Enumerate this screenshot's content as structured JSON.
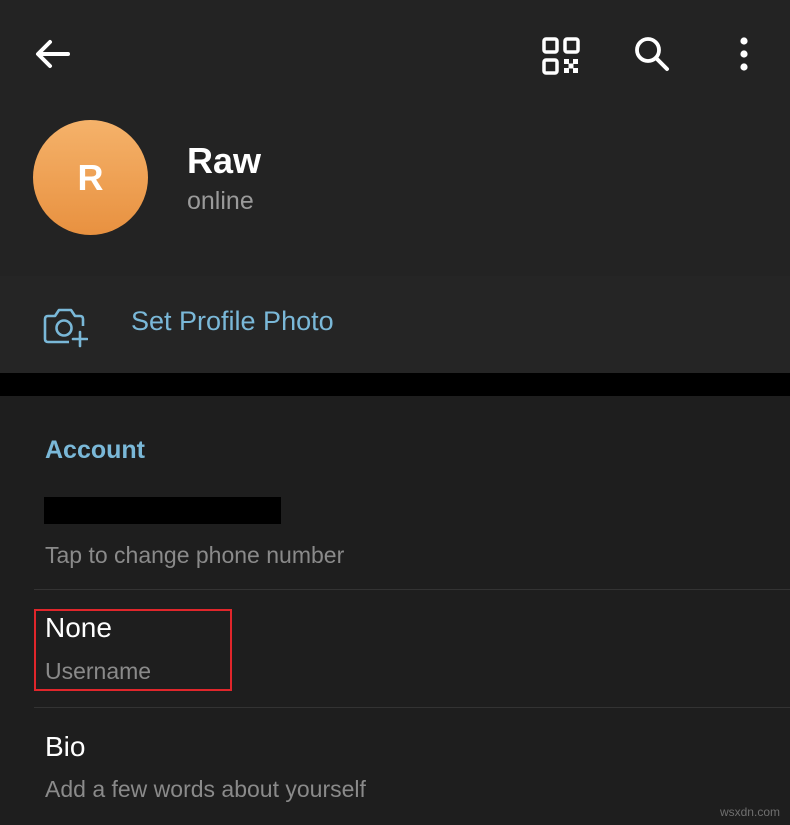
{
  "header": {
    "back_icon": "arrow-left-icon",
    "qr_icon": "qr-code-icon",
    "search_icon": "search-icon",
    "more_icon": "more-vertical-icon"
  },
  "profile": {
    "initial": "R",
    "name": "Raw",
    "status": "online",
    "avatar_color_top": "#f5b26a",
    "avatar_color_bottom": "#e89140"
  },
  "photo_row": {
    "icon": "camera-add-icon",
    "label": "Set Profile Photo"
  },
  "account": {
    "title": "Account",
    "phone": {
      "hint": "Tap to change phone number"
    },
    "username": {
      "value": "None",
      "label": "Username"
    },
    "bio": {
      "title": "Bio",
      "placeholder": "Add a few words about yourself"
    }
  },
  "watermark": "wsxdn.com",
  "colors": {
    "accent": "#7ab8d8",
    "highlight": "#e0262b",
    "background": "#1e1e1e"
  }
}
